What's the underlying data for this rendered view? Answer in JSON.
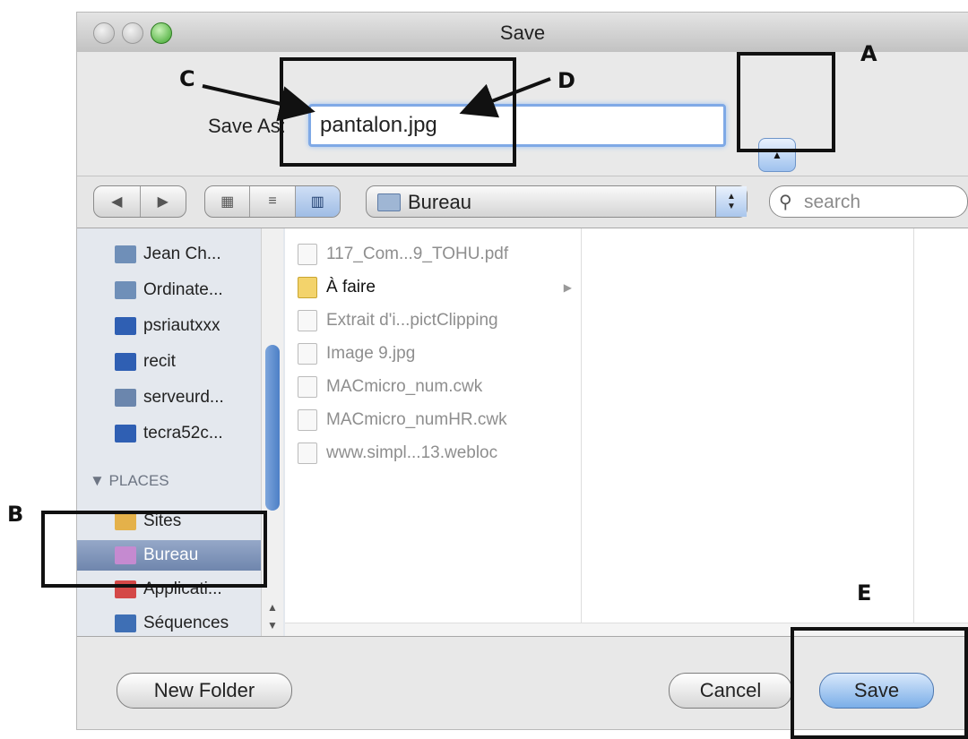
{
  "window": {
    "title": "Save"
  },
  "save_as": {
    "label": "Save As:",
    "filename": "pantalon.jpg"
  },
  "toolbar": {
    "back_glyph": "◀",
    "forward_glyph": "▶",
    "view_icon_glyph": "▦",
    "view_list_glyph": "≡",
    "view_column_glyph": "▥",
    "location": "Bureau",
    "search_placeholder": "search"
  },
  "sidebar": {
    "devices": [
      {
        "label": "Jean Ch...",
        "icon": "computer-icon",
        "color": "#6f8fb8"
      },
      {
        "label": "Ordinate...",
        "icon": "computer-icon",
        "color": "#6f8fb8"
      },
      {
        "label": "psriautxxx",
        "icon": "monitor-icon",
        "color": "#2f5fb3"
      },
      {
        "label": "recit",
        "icon": "monitor-icon",
        "color": "#2f5fb3"
      },
      {
        "label": "serveurd...",
        "icon": "monitor-icon",
        "color": "#6b86ad"
      },
      {
        "label": "tecra52c...",
        "icon": "monitor-icon",
        "color": "#2f5fb3"
      }
    ],
    "places_label": "▼ PLACES",
    "places": [
      {
        "label": "Sites",
        "icon": "sites-folder-icon",
        "color": "#e4b14a",
        "selected": false
      },
      {
        "label": "Bureau",
        "icon": "desktop-icon",
        "color": "#c58ad0",
        "selected": true
      },
      {
        "label": "Applicati...",
        "icon": "applications-icon",
        "color": "#d44848",
        "selected": false
      },
      {
        "label": "Séquences",
        "icon": "movies-icon",
        "color": "#3e6fb5",
        "selected": false
      }
    ]
  },
  "files": [
    {
      "name": "117_Com...9_TOHU.pdf",
      "icon": "pdf-icon",
      "folder": false
    },
    {
      "name": "À faire",
      "icon": "folder-icon",
      "folder": true
    },
    {
      "name": "Extrait d'i...pictClipping",
      "icon": "clipping-icon",
      "folder": false
    },
    {
      "name": "Image 9.jpg",
      "icon": "image-icon",
      "folder": false
    },
    {
      "name": "MACmicro_num.cwk",
      "icon": "document-icon",
      "folder": false
    },
    {
      "name": "MACmicro_numHR.cwk",
      "icon": "document-icon",
      "folder": false
    },
    {
      "name": "www.simpl...13.webloc",
      "icon": "webloc-icon",
      "folder": false
    }
  ],
  "buttons": {
    "new_folder": "New Folder",
    "cancel": "Cancel",
    "save": "Save"
  },
  "annotations": {
    "a": "A",
    "b": "B",
    "c": "C",
    "d": "D",
    "e": "E"
  }
}
